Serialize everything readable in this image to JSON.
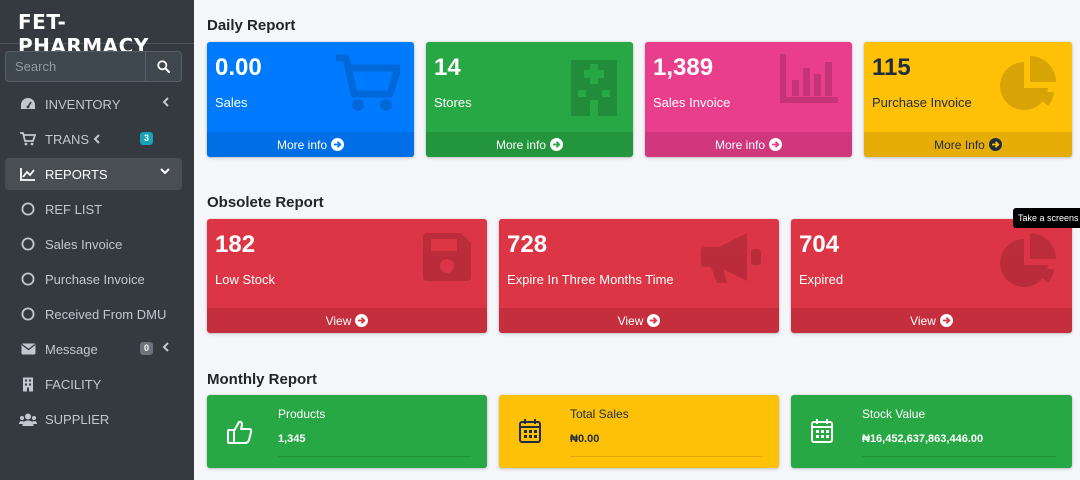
{
  "brand": "FET-PHARMACY",
  "search": {
    "placeholder": "Search"
  },
  "nav": [
    {
      "label": "INVENTORY",
      "icon": "gauge-icon"
    },
    {
      "label": "TRANS",
      "icon": "cart-icon",
      "badge": "3"
    },
    {
      "label": "REPORTS",
      "icon": "chart-line-icon"
    },
    {
      "label": "REF LIST",
      "icon": "circle-icon"
    },
    {
      "label": "Sales Invoice",
      "icon": "circle-icon"
    },
    {
      "label": "Purchase Invoice",
      "icon": "circle-icon"
    },
    {
      "label": "Received From DMU",
      "icon": "circle-icon"
    },
    {
      "label": "Message",
      "icon": "envelope-icon",
      "badge": "0"
    },
    {
      "label": "FACILITY",
      "icon": "building-icon"
    },
    {
      "label": "SUPPLIER",
      "icon": "users-icon"
    }
  ],
  "daily": {
    "title": "Daily Report",
    "boxes": [
      {
        "value": "0.00",
        "label": "Sales",
        "footer": "More info",
        "color": "#007bff"
      },
      {
        "value": "14",
        "label": "Stores",
        "footer": "More info",
        "color": "#28a745"
      },
      {
        "value": "1,389",
        "label": "Sales Invoice",
        "footer": "More info",
        "color": "#e83e8c"
      },
      {
        "value": "115",
        "label": "Purchase Invoice",
        "footer": "More Info",
        "color": "#ffc107"
      }
    ]
  },
  "obsolete": {
    "title": "Obsolete Report",
    "boxes": [
      {
        "value": "182",
        "label": "Low Stock",
        "footer": "View",
        "color": "#dc3545"
      },
      {
        "value": "728",
        "label": "Expire In Three Months Time",
        "footer": "View",
        "color": "#dc3545"
      },
      {
        "value": "704",
        "label": "Expired",
        "footer": "View",
        "color": "#dc3545"
      }
    ]
  },
  "tooltip": "Take a screens",
  "monthly": {
    "title": "Monthly Report",
    "boxes": [
      {
        "title": "Products",
        "value": "1,345",
        "color": "#28a745"
      },
      {
        "title": "Total Sales",
        "value": "₦0.00",
        "color": "#ffc107"
      },
      {
        "title": "Stock Value",
        "value": "₦16,452,637,863,446.00",
        "color": "#28a745"
      }
    ]
  }
}
